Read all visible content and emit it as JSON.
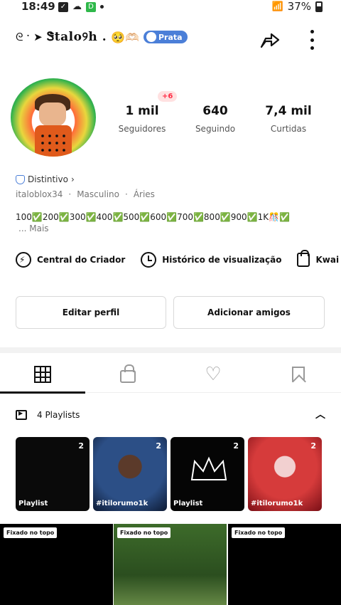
{
  "status_bar": {
    "time": "18:49",
    "battery": "37%"
  },
  "header": {
    "username": "Ꮥtalo୨h .",
    "emojis": "🥺🫶🏻",
    "badge": "Prata"
  },
  "stats": [
    {
      "value": "1 mil",
      "label": "Seguidores"
    },
    {
      "value": "640",
      "label": "Seguindo"
    },
    {
      "value": "7,4 mil",
      "label": "Curtidas"
    }
  ],
  "followers_delta": "+6",
  "profile": {
    "distintivo": "Distintivo",
    "handle": "italoblox34",
    "gender": "Masculino",
    "sign": "Áries",
    "bio": "100✅200✅300✅400✅500✅600✅700✅800✅900✅1K🎊✅",
    "bio_more": "... Mais"
  },
  "shortcuts": [
    {
      "label": "Central do Criador",
      "icon": "bolt-icon"
    },
    {
      "label": "Histórico de visualização",
      "icon": "clock-icon"
    },
    {
      "label": "Kwai Sh",
      "icon": "shopping-bag-icon"
    }
  ],
  "actions": {
    "edit": "Editar perfil",
    "add": "Adicionar amigos"
  },
  "tabs": [
    "grid-icon",
    "lock-icon",
    "heart-icon",
    "bookmark-icon"
  ],
  "playlists": {
    "title": "4 Playlists",
    "items": [
      {
        "count": "2",
        "caption": "Playlist"
      },
      {
        "count": "2",
        "caption": "#itilorumo1k"
      },
      {
        "count": "2",
        "caption": "Playlist"
      },
      {
        "count": "2",
        "caption": "#itilorumo1k"
      }
    ]
  },
  "videos": [
    {
      "pin": "Fixado no topo"
    },
    {
      "pin": "Fixado no topo"
    },
    {
      "pin": "Fixado no topo"
    }
  ],
  "colors": {
    "badge_blue": "#4b7fd8",
    "accent_red": "#ff2b44"
  }
}
